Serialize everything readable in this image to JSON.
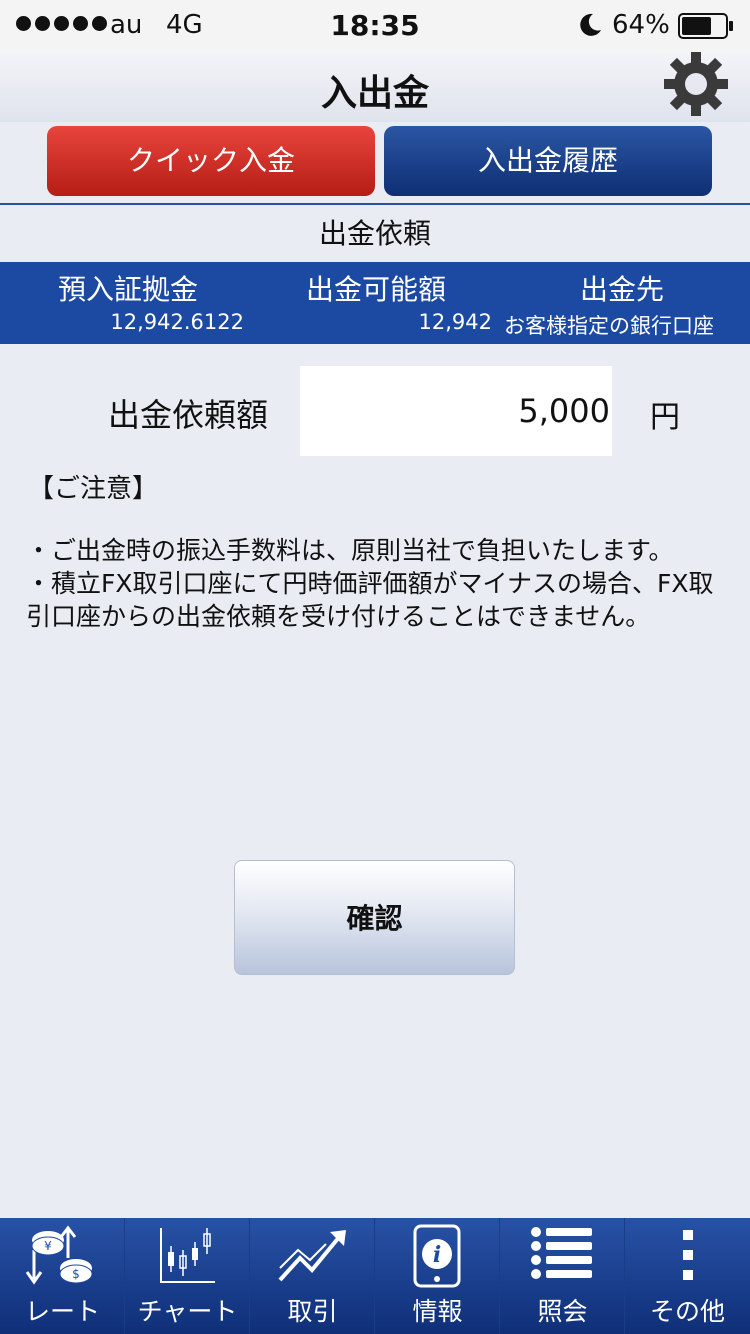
{
  "status": {
    "carrier": "au",
    "network": "4G",
    "time": "18:35",
    "battery": "64%"
  },
  "nav": {
    "title": "入出金"
  },
  "segments": {
    "quick": "クイック入金",
    "history": "入出金履歴"
  },
  "subtitle": "出金依頼",
  "info": {
    "headers": [
      "預入証拠金",
      "出金可能額",
      "出金先"
    ],
    "deposit": "12,942.6122",
    "withdrawable": "12,942",
    "destination": "お客様指定の銀行口座"
  },
  "form": {
    "label": "出金依頼額",
    "value": "5,000",
    "unit": "円"
  },
  "notice": {
    "heading": "【ご注意】",
    "line1": "・ご出金時の振込手数料は、原則当社で負担いたします。",
    "line2": "・積立FX取引口座にて円時価評価額がマイナスの場合、FX取引口座からの出金依頼を受け付けることはできません。"
  },
  "confirm_label": "確認",
  "tabs": [
    {
      "label": "レート",
      "icon": "rate-icon"
    },
    {
      "label": "チャート",
      "icon": "chart-icon"
    },
    {
      "label": "取引",
      "icon": "trade-icon"
    },
    {
      "label": "情報",
      "icon": "info-icon"
    },
    {
      "label": "照会",
      "icon": "list-icon"
    },
    {
      "label": "その他",
      "icon": "more-icon"
    }
  ]
}
